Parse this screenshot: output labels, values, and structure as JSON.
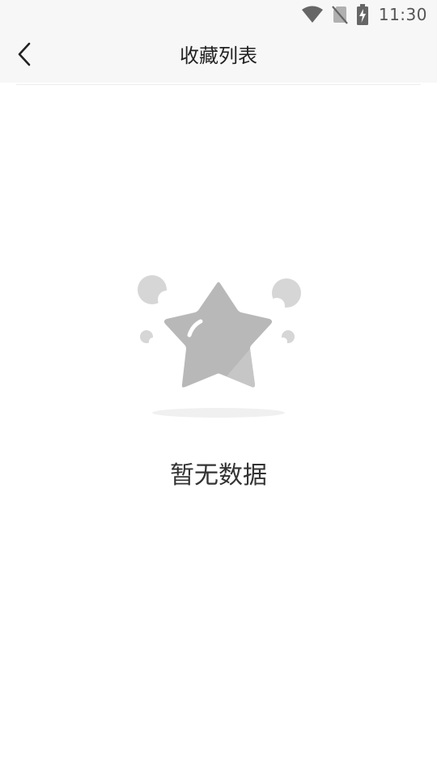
{
  "status_bar": {
    "time": "11:30",
    "icons": [
      "wifi-icon",
      "no-sim-icon",
      "battery-charging-icon"
    ]
  },
  "header": {
    "back_icon": "chevron-left-icon",
    "title": "收藏列表"
  },
  "empty_state": {
    "illustration": "star-icon",
    "message": "暂无数据"
  },
  "colors": {
    "header_bg": "#f7f7f7",
    "star": "#b6b6b6",
    "decor": "#d6d6d6",
    "text": "#333333"
  }
}
